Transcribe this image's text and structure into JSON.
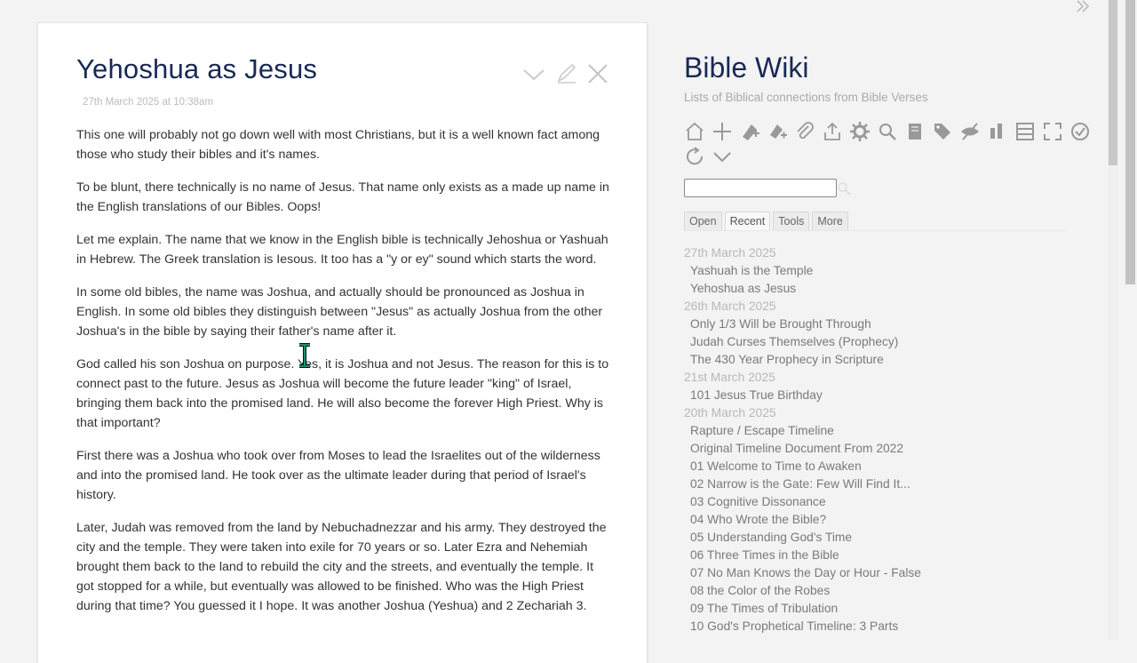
{
  "tiddler": {
    "title": "Yehoshua as Jesus",
    "date": "27th March 2025 at 10:38am",
    "paragraphs": [
      "This one will probably not go down well with most Christians, but it is a well known fact among those who study their bibles and it's names.",
      "To be blunt, there technically is no name of Jesus. That name only exists as a made up name in the English translations of our Bibles. Oops!",
      "Let me explain. The name that we know in the English bible is technically Jehoshua or Yashuah in Hebrew. The Greek translation is Iesous. It too has a \"y or ey\" sound which starts the word.",
      "In some old bibles, the name was Joshua, and actually should be pronounced as Joshua in English. In some old bibles they distinguish between \"Jesus\" as actually Joshua from the other Joshua's in the bible by saying their father's name after it.",
      "God called his son Joshua on purpose. Yes, it is Joshua and not Jesus. The reason for this is to connect past to the future. Jesus as Joshua will become the future leader \"king\" of Israel, bringing them back into the promised land. He will also become the forever High Priest. Why is that important?",
      "First there was a Joshua who took over from Moses to lead the Israelites out of the wilderness and into the promised land. He took over as the ultimate leader during that period of Israel's history.",
      "Later, Judah was removed from the land by Nebuchadnezzar and his army. They destroyed the city and the temple. They were taken into exile for 70 years or so. Later Ezra and Nehemiah brought them back to the land to rebuild the city and the streets, and eventually the temple. It got stopped for a while, but eventually was allowed to be finished. Who was the High Priest during that time? You guessed it I hope. It was another Joshua (Yeshua) and 2 Zechariah 3."
    ],
    "controls": {
      "more": "chevron-down-icon",
      "edit": "pencil-icon",
      "close": "close-icon"
    }
  },
  "site": {
    "title": "Bible Wiki",
    "subtitle": "Lists of Biblical connections from Bible Verses"
  },
  "toolbar": [
    "home-icon",
    "new-tiddler-icon",
    "new-journal-icon",
    "new-image-icon",
    "attachment-icon",
    "export-icon",
    "control-panel-icon",
    "advanced-search-icon",
    "manager-icon",
    "tag-manager-icon",
    "hide-icon",
    "layout-icon",
    "storyview-icon",
    "fullscreen-icon",
    "save-icon",
    "refresh-icon",
    "more-chevron-icon"
  ],
  "search": {
    "value": "",
    "placeholder": ""
  },
  "tabs": [
    {
      "label": "Open",
      "active": false
    },
    {
      "label": "Recent",
      "active": true
    },
    {
      "label": "Tools",
      "active": false
    },
    {
      "label": "More",
      "active": false
    }
  ],
  "recent": [
    {
      "date": "27th March 2025",
      "items": [
        "Yashuah is the Temple",
        "Yehoshua as Jesus"
      ]
    },
    {
      "date": "26th March 2025",
      "items": [
        "Only 1/3 Will be Brought Through",
        "Judah Curses Themselves (Prophecy)",
        "The 430 Year Prophecy in Scripture"
      ]
    },
    {
      "date": "21st March 2025",
      "items": [
        "101 Jesus True Birthday"
      ]
    },
    {
      "date": "20th March 2025",
      "items": [
        "Rapture / Escape Timeline",
        "Original Timeline Document From 2022",
        "01 Welcome to Time to Awaken",
        "02 Narrow is the Gate: Few Will Find It...",
        "03 Cognitive Dissonance",
        "04 Who Wrote the Bible?",
        "05 Understanding God's Time",
        "06 Three Times in the Bible",
        "07 No Man Knows the Day or Hour - False",
        "08 the Color of the Robes",
        "09 The Times of Tribulation",
        "10 God's Prophetical Timeline: 3 Parts"
      ]
    }
  ]
}
